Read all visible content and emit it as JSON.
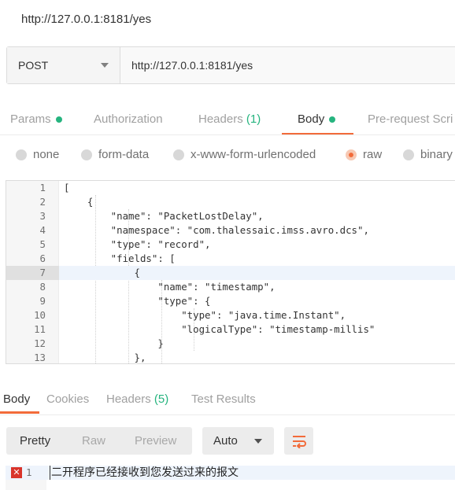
{
  "window": {
    "title": "http://127.0.0.1:8181/yes"
  },
  "request": {
    "method": "POST",
    "url": "http://127.0.0.1:8181/yes"
  },
  "tabs": {
    "params": "Params",
    "authorization": "Authorization",
    "headers": "Headers",
    "headers_count": "(1)",
    "body": "Body",
    "prerequest": "Pre-request Scri"
  },
  "body_types": {
    "none": "none",
    "form_data": "form-data",
    "urlencoded": "x-www-form-urlencoded",
    "raw": "raw",
    "binary": "binary",
    "selected": "raw"
  },
  "editor": {
    "current_line": 7,
    "lines": [
      {
        "n": "1",
        "text": "["
      },
      {
        "n": "2",
        "text": "    {"
      },
      {
        "n": "3",
        "text": "        \"name\": \"PacketLostDelay\","
      },
      {
        "n": "4",
        "text": "        \"namespace\": \"com.thalessaic.imss.avro.dcs\","
      },
      {
        "n": "5",
        "text": "        \"type\": \"record\","
      },
      {
        "n": "6",
        "text": "        \"fields\": ["
      },
      {
        "n": "7",
        "text": "            {"
      },
      {
        "n": "8",
        "text": "                \"name\": \"timestamp\","
      },
      {
        "n": "9",
        "text": "                \"type\": {"
      },
      {
        "n": "10",
        "text": "                    \"type\": \"java.time.Instant\","
      },
      {
        "n": "11",
        "text": "                    \"logicalType\": \"timestamp-millis\""
      },
      {
        "n": "12",
        "text": "                }"
      },
      {
        "n": "13",
        "text": "            },"
      }
    ]
  },
  "response_tabs": {
    "body": "Body",
    "cookies": "Cookies",
    "headers": "Headers",
    "headers_count": "(5)",
    "test_results": "Test Results"
  },
  "response_toolbar": {
    "pretty": "Pretty",
    "raw": "Raw",
    "preview": "Preview",
    "language": "Auto",
    "wrap_icon": "wrap-lines-icon"
  },
  "response": {
    "line_number": "1",
    "error_icon_glyph": "✕",
    "text": "二开程序已经接收到您发送过来的报文"
  },
  "colors": {
    "accent": "#f26b3a",
    "status_green": "#26b47f",
    "error_red": "#d9342b"
  }
}
